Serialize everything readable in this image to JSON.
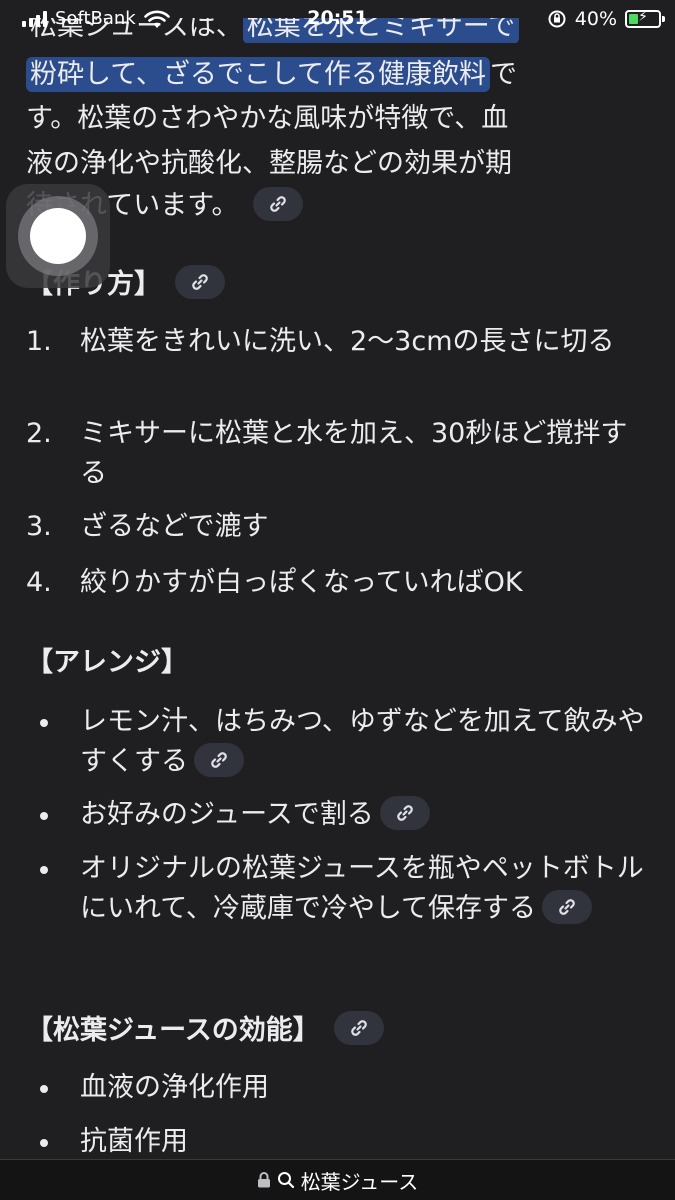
{
  "status_bar": {
    "carrier": "SoftBank",
    "time": "20:51",
    "battery_percent": "40%",
    "battery_level": 0.4,
    "icons": [
      "signal-icon",
      "wifi-icon",
      "orientation-lock-icon",
      "battery-charging-icon"
    ]
  },
  "intro": {
    "cut_top": "松葉ジュースは、",
    "cut_top_highlight": "松葉を水とミキサーで",
    "line2_highlight": "粉砕して、ざるでこして作る健康飲料",
    "line2_rest": "で",
    "line3": "す。松葉のさわやかな風味が特徴で、血",
    "line4": "液の浄化や抗酸化、整腸などの効果が期",
    "line5": "待されています。"
  },
  "section_howto": {
    "title": "【作り方】",
    "steps": [
      {
        "marker": "1.",
        "text": "松葉をきれいに洗い、2〜3cmの長さに切る"
      },
      {
        "marker": "2.",
        "text": "ミキサーに松葉と水を加え、30秒ほど撹拌する"
      },
      {
        "marker": "3.",
        "text": "ざるなどで漉す"
      },
      {
        "marker": "4.",
        "text": "絞りかすが白っぽくなっていればOK"
      }
    ]
  },
  "section_arrange": {
    "title": "【アレンジ】",
    "items": [
      "レモン汁、はちみつ、ゆずなどを加えて飲みやすくする",
      "お好みのジュースで割る",
      "オリジナルの松葉ジュースを瓶やペットボトルにいれて、冷蔵庫で冷やして保存する"
    ]
  },
  "section_effects": {
    "title": "【松葉ジュースの効能】",
    "items": [
      "血液の浄化作用",
      "抗菌作用"
    ]
  },
  "url_bar": {
    "query": "松葉ジュース",
    "icons": [
      "lock-icon",
      "search-icon"
    ]
  },
  "colors": {
    "background": "#1f1f21",
    "text": "#ececef",
    "highlight": "#2b4d8e",
    "link_pill": "#31343c"
  }
}
